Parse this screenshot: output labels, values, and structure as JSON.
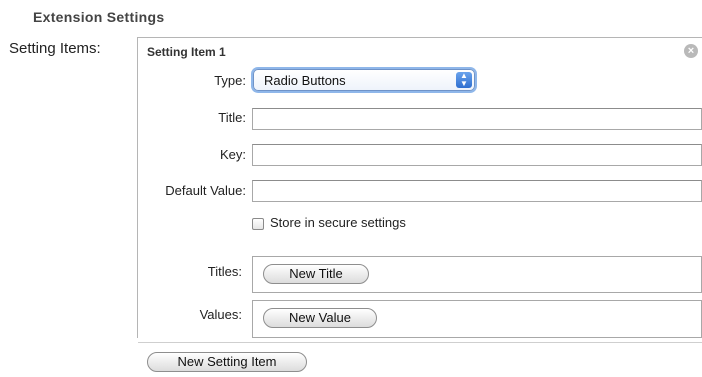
{
  "section": {
    "title": "Extension Settings"
  },
  "setting_items": {
    "label": "Setting Items:",
    "item": {
      "header": "Setting Item 1",
      "close_glyph": "×",
      "type_label": "Type:",
      "type_value": "Radio Buttons",
      "title_label": "Title:",
      "title_value": "",
      "key_label": "Key:",
      "key_value": "",
      "default_label": "Default Value:",
      "default_value": "",
      "secure_checkbox_label": "Store in secure settings",
      "secure_checked": false,
      "titles_label": "Titles:",
      "new_title_button": "New Title",
      "values_label": "Values:",
      "new_value_button": "New Value"
    },
    "new_item_button": "New Setting Item"
  },
  "colors": {
    "focus_ring": "#8fb7ea",
    "popup_arrows": "#2f6fd0",
    "panel_border": "#b5b5b5"
  },
  "icons": {
    "close": "close-icon",
    "popup": "chevron-up-down-icon"
  }
}
